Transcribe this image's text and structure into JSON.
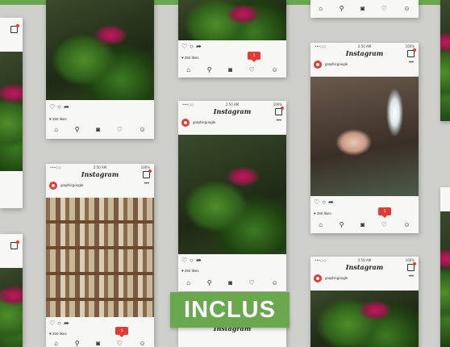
{
  "status": {
    "left": "•••○○",
    "time": "2:50 AM",
    "right": "100%"
  },
  "brand": "Instagram",
  "username": "graphicgoogle",
  "likes": "♥ 250 likes",
  "notification_count": "1",
  "badge_text": "INCLUS",
  "accent_color": "#6aa84f",
  "icons": {
    "like": "♡",
    "comment": "○",
    "share": "➦",
    "home": "⌂",
    "search": "⚲",
    "camera": "◙",
    "heart": "♡",
    "profile": "☺",
    "more": "•••"
  }
}
